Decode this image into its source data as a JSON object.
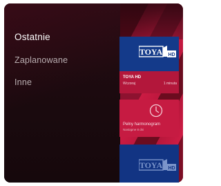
{
  "menu": {
    "items": [
      {
        "label": "Ostatnie",
        "active": true
      },
      {
        "label": "Zaplanowane",
        "active": false
      },
      {
        "label": "Inne",
        "active": false
      }
    ]
  },
  "cards": {
    "recent": {
      "logo_text": "TOYA",
      "logo_badge": "HD",
      "channel": "TOYA HD",
      "day": "Wczoraj",
      "duration": "1 minuta"
    },
    "schedule": {
      "icon": "clock-icon",
      "title": "Pełny harmonogram",
      "subtitle": "Nastąpne 8 dni"
    },
    "next": {
      "logo_text": "TOYA",
      "logo_badge": "HD"
    }
  },
  "colors": {
    "background": "#1d0c11",
    "accent": "#c81a41",
    "logo_blue": "#143a8a",
    "text": "#ffffff",
    "muted_text": "#b9aeb1"
  }
}
